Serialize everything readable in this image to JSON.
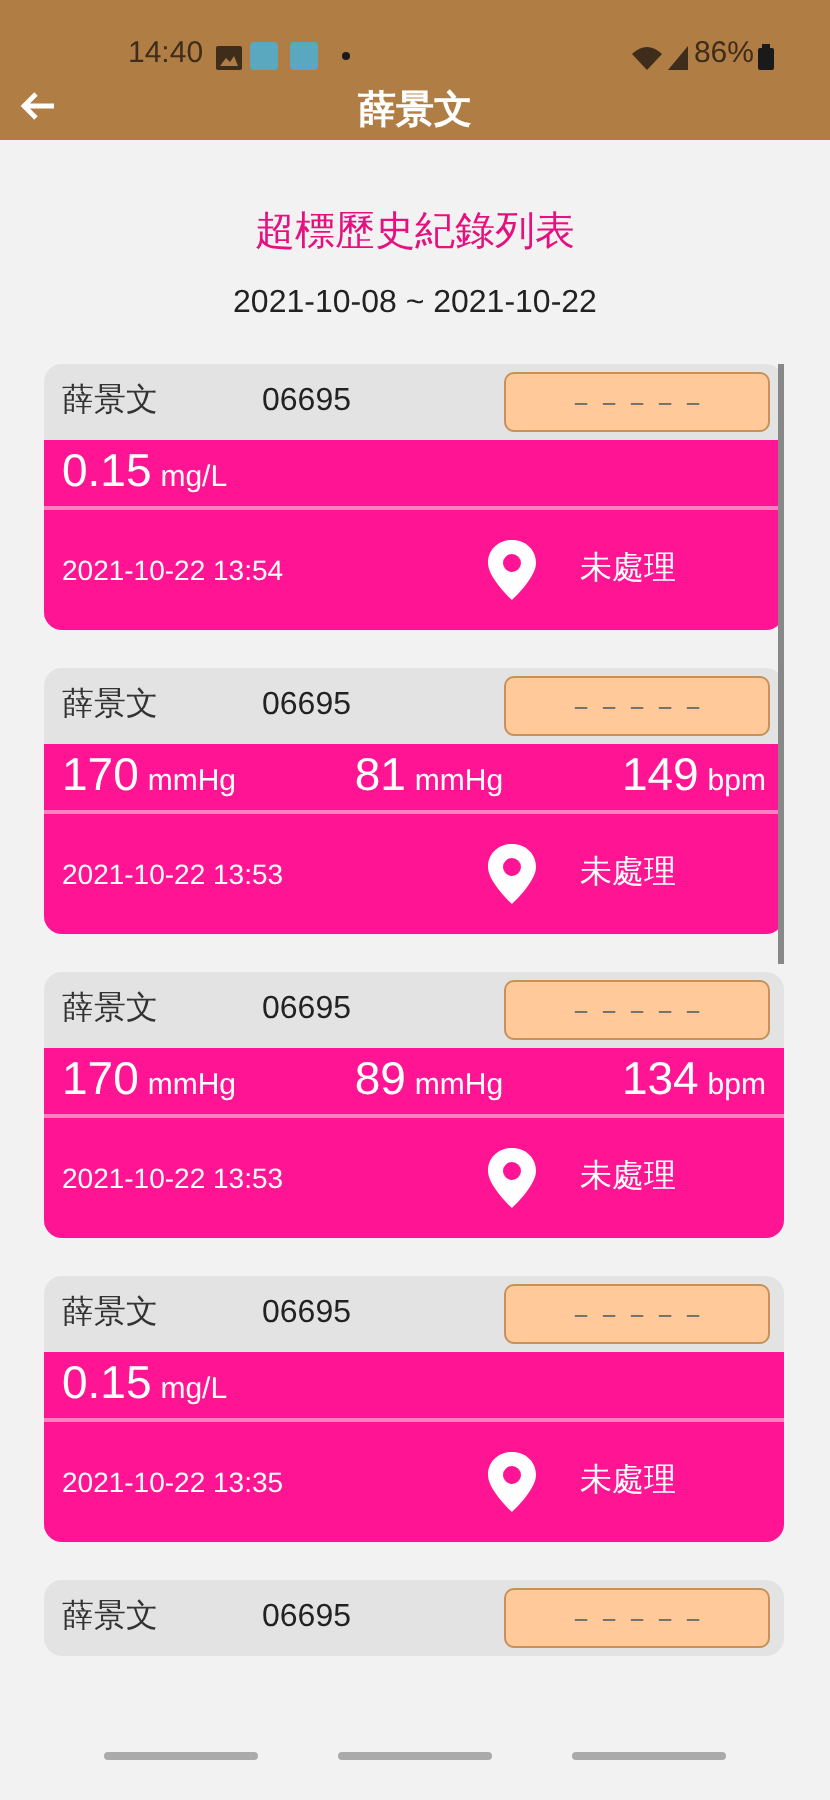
{
  "status_bar": {
    "time": "14:40",
    "battery": "86%"
  },
  "header": {
    "title": "薛景文"
  },
  "page_title": "超標歷史紀錄列表",
  "date_range": "2021-10-08 ~ 2021-10-22",
  "records": [
    {
      "name": "薛景文",
      "id": "06695",
      "action": "－－－－－",
      "readings": [
        {
          "value": "0.15",
          "unit": "mg/L"
        }
      ],
      "time": "2021-10-22 13:54",
      "status": "未處理"
    },
    {
      "name": "薛景文",
      "id": "06695",
      "action": "－－－－－",
      "readings": [
        {
          "value": "170",
          "unit": "mmHg"
        },
        {
          "value": "81",
          "unit": "mmHg"
        },
        {
          "value": "149",
          "unit": "bpm"
        }
      ],
      "time": "2021-10-22 13:53",
      "status": "未處理"
    },
    {
      "name": "薛景文",
      "id": "06695",
      "action": "－－－－－",
      "readings": [
        {
          "value": "170",
          "unit": "mmHg"
        },
        {
          "value": "89",
          "unit": "mmHg"
        },
        {
          "value": "134",
          "unit": "bpm"
        }
      ],
      "time": "2021-10-22 13:53",
      "status": "未處理"
    },
    {
      "name": "薛景文",
      "id": "06695",
      "action": "－－－－－",
      "readings": [
        {
          "value": "0.15",
          "unit": "mg/L"
        }
      ],
      "time": "2021-10-22 13:35",
      "status": "未處理"
    },
    {
      "name": "薛景文",
      "id": "06695",
      "action": "－－－－－"
    }
  ]
}
